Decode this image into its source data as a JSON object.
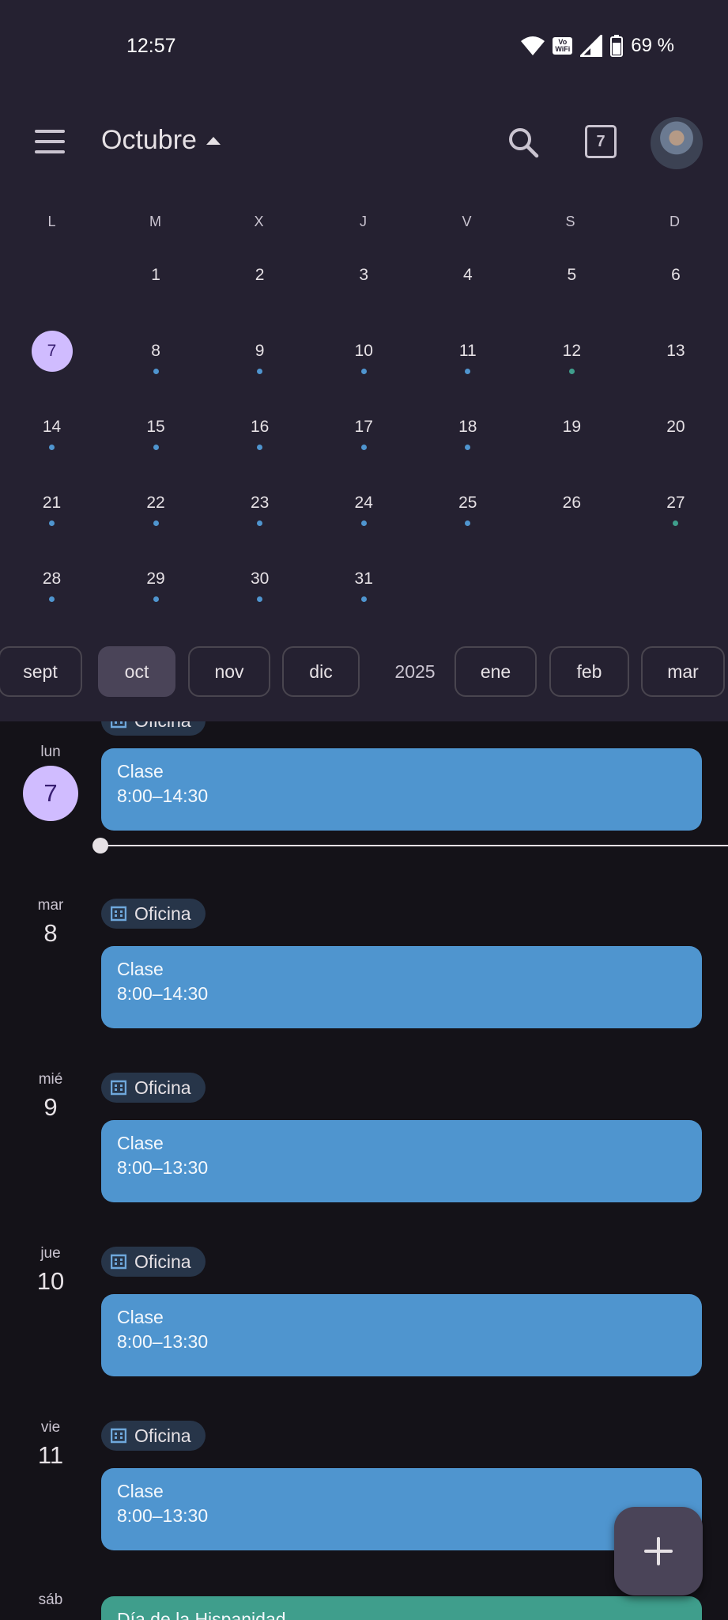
{
  "status_bar": {
    "time": "12:57",
    "battery": "69 %",
    "vowifi": [
      "Vo",
      "WiFi"
    ]
  },
  "app_bar": {
    "month_title": "Octubre",
    "today_number": "7"
  },
  "calendar": {
    "weekdays": [
      "L",
      "M",
      "X",
      "J",
      "V",
      "S",
      "D"
    ],
    "weeks": [
      [
        {
          "d": ""
        },
        {
          "d": "1"
        },
        {
          "d": "2"
        },
        {
          "d": "3"
        },
        {
          "d": "4"
        },
        {
          "d": "5"
        },
        {
          "d": "6"
        }
      ],
      [
        {
          "d": "7",
          "today": true
        },
        {
          "d": "8",
          "dot": "blue"
        },
        {
          "d": "9",
          "dot": "blue"
        },
        {
          "d": "10",
          "dot": "blue"
        },
        {
          "d": "11",
          "dot": "blue"
        },
        {
          "d": "12",
          "dot": "green"
        },
        {
          "d": "13"
        }
      ],
      [
        {
          "d": "14",
          "dot": "blue"
        },
        {
          "d": "15",
          "dot": "blue"
        },
        {
          "d": "16",
          "dot": "blue"
        },
        {
          "d": "17",
          "dot": "blue"
        },
        {
          "d": "18",
          "dot": "blue"
        },
        {
          "d": "19"
        },
        {
          "d": "20"
        }
      ],
      [
        {
          "d": "21",
          "dot": "blue"
        },
        {
          "d": "22",
          "dot": "blue"
        },
        {
          "d": "23",
          "dot": "blue"
        },
        {
          "d": "24",
          "dot": "blue"
        },
        {
          "d": "25",
          "dot": "blue"
        },
        {
          "d": "26"
        },
        {
          "d": "27",
          "dot": "green"
        }
      ],
      [
        {
          "d": "28",
          "dot": "blue"
        },
        {
          "d": "29",
          "dot": "blue"
        },
        {
          "d": "30",
          "dot": "blue"
        },
        {
          "d": "31",
          "dot": "blue"
        },
        {
          "d": ""
        },
        {
          "d": ""
        },
        {
          "d": ""
        }
      ]
    ],
    "dot_colors": {
      "blue": "#4f95cf",
      "green": "#3f9e8c"
    }
  },
  "month_chips": {
    "items": [
      "sept",
      "oct",
      "nov",
      "dic",
      "ene",
      "feb",
      "mar"
    ],
    "selected": "oct",
    "year": "2025"
  },
  "agenda": {
    "partial_chip": "Oficina",
    "days": [
      {
        "abbr": "lun",
        "num": "7",
        "today": true,
        "office": null,
        "event": {
          "title": "Clase",
          "time": "8:00–14:30"
        }
      },
      {
        "abbr": "mar",
        "num": "8",
        "office": "Oficina",
        "event": {
          "title": "Clase",
          "time": "8:00–14:30"
        }
      },
      {
        "abbr": "mié",
        "num": "9",
        "office": "Oficina",
        "event": {
          "title": "Clase",
          "time": "8:00–13:30"
        }
      },
      {
        "abbr": "jue",
        "num": "10",
        "office": "Oficina",
        "event": {
          "title": "Clase",
          "time": "8:00–13:30"
        }
      },
      {
        "abbr": "vie",
        "num": "11",
        "office": "Oficina",
        "event": {
          "title": "Clase",
          "time": "8:00–13:30"
        }
      },
      {
        "abbr": "sáb",
        "num": "",
        "office": null,
        "event": {
          "title": "Día de la Hispanidad",
          "time": ""
        }
      }
    ]
  },
  "fab": {
    "icon": "plus-icon"
  }
}
